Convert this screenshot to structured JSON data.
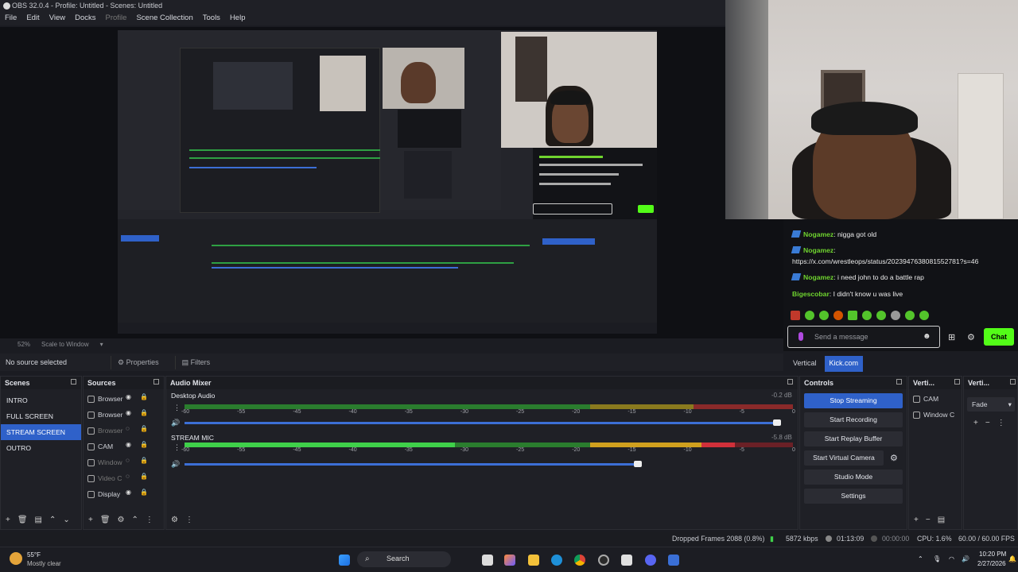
{
  "window": {
    "title": "OBS 32.0.4 - Profile: Untitled - Scenes: Untitled"
  },
  "menu": [
    "File",
    "Edit",
    "View",
    "Docks",
    "Profile",
    "Scene Collection",
    "Tools",
    "Help"
  ],
  "preview": {
    "zoom": "52%",
    "scale_mode": "Scale to Window"
  },
  "chat": {
    "messages": [
      {
        "user": "Nogamez",
        "text": "nigga got old"
      },
      {
        "user": "Nogamez",
        "text": ""
      },
      {
        "user": "",
        "text": "https://x.com/wrestleops/status/2023947638081552781?s=46"
      },
      {
        "user": "Nogamez",
        "text": "i need john to do a battle rap"
      },
      {
        "user": "Bigescobar",
        "text": "I didn't know u was live"
      }
    ],
    "placeholder": "Send a message",
    "send_label": "Chat",
    "user_color": "#6fd42f",
    "accent": "#53fc18"
  },
  "dock_tabs": [
    "Vertical",
    "Kick.com"
  ],
  "source_bar": {
    "status": "No source selected",
    "properties": "Properties",
    "filters": "Filters"
  },
  "scenes": {
    "title": "Scenes",
    "items": [
      "INTRO",
      "FULL SCREEN",
      "STREAM SCREEN",
      "OUTRO"
    ],
    "selected": 2
  },
  "sources": {
    "title": "Sources",
    "items": [
      "Browser",
      "Browser",
      "Browser",
      "CAM",
      "Window",
      "Video C",
      "Display"
    ]
  },
  "mixer": {
    "title": "Audio Mixer",
    "ticks": [
      "-60",
      "-55",
      "-45",
      "-40",
      "-35",
      "-30",
      "-25",
      "-20",
      "-15",
      "-10",
      "-5",
      "0"
    ],
    "channels": [
      {
        "name": "Desktop Audio",
        "db": "-0.2 dB",
        "volume": 0.98
      },
      {
        "name": "STREAM MIC",
        "db": "-5.8 dB",
        "volume": 0.75
      }
    ]
  },
  "controls": {
    "title": "Controls",
    "buttons": [
      "Stop Streaming",
      "Start Recording",
      "Start Replay Buffer",
      "Start Virtual Camera",
      "Studio Mode",
      "Settings"
    ]
  },
  "vertical_sources": {
    "title": "Verti...",
    "items": [
      "CAM",
      "Window C"
    ]
  },
  "vertical_transitions": {
    "title": "Verti...",
    "transition": "Fade"
  },
  "status": {
    "dropped": "Dropped Frames 2088 (0.8%)",
    "bitrate": "5872 kbps",
    "stream_time": "01:13:09",
    "rec_time": "00:00:00",
    "cpu": "CPU: 1.6%",
    "fps": "60.00 / 60.00 FPS"
  },
  "taskbar": {
    "weather_temp": "55°F",
    "weather_desc": "Mostly clear",
    "search": "Search",
    "time": "10:20 PM",
    "date": "2/27/2026"
  }
}
